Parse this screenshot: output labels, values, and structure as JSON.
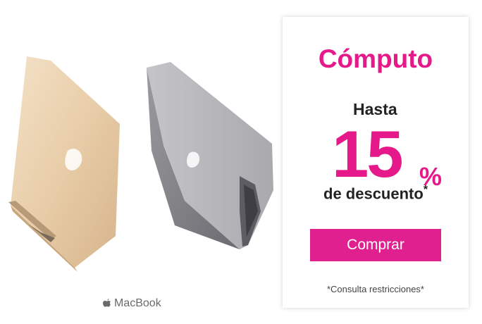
{
  "brand": {
    "label": "MacBook"
  },
  "promo": {
    "title": "Cómputo",
    "prefix": "Hasta",
    "amount": "15",
    "percent_sign": "%",
    "suffix": "de descuento",
    "asterisk": "*",
    "button_label": "Comprar",
    "note": "*Consulta restricciones*"
  },
  "colors": {
    "accent": "#e6198a",
    "button": "#e0208f"
  }
}
